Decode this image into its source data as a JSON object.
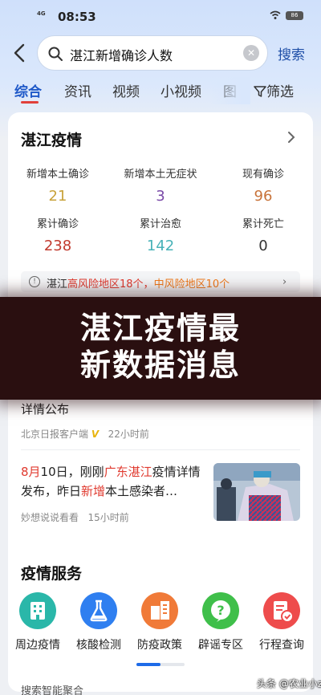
{
  "status_bar": {
    "network": "4G",
    "time": "08:53",
    "battery": "86"
  },
  "search": {
    "query": "湛江新增确诊人数",
    "button_label": "搜索"
  },
  "tabs": [
    {
      "label": "综合",
      "active": true
    },
    {
      "label": "资讯"
    },
    {
      "label": "视频"
    },
    {
      "label": "小视频"
    },
    {
      "label": "图"
    }
  ],
  "filter_label": "筛选",
  "card": {
    "title": "湛江疫情",
    "stats": [
      {
        "label": "新增本土确诊",
        "value": "21",
        "color": "#c8a23a"
      },
      {
        "label": "新增本土无症状",
        "value": "3",
        "color": "#7a4aa8"
      },
      {
        "label": "现有确诊",
        "value": "96",
        "color": "#c8733a"
      },
      {
        "label": "累计确诊",
        "value": "238",
        "color": "#c23a2e"
      },
      {
        "label": "累计治愈",
        "value": "142",
        "color": "#48b2b8"
      },
      {
        "label": "累计死亡",
        "value": "0",
        "color": "#333333"
      }
    ],
    "risk": {
      "prefix": "湛江",
      "high": "高风险地区18个，",
      "mid": "中风险地区10个"
    }
  },
  "overlay": {
    "line1": "湛江疫情最",
    "line2": "新数据消息"
  },
  "news": [
    {
      "title": "详情公布",
      "source": "北京日报客户端",
      "badge": "V",
      "time": "22小时前"
    },
    {
      "title_parts": [
        "8月",
        "10日，刚刚",
        "广东湛江",
        "疫情详情发布，昨日",
        "新增",
        "本土感染者…"
      ],
      "source": "妙想说说看看",
      "time": "15小时前"
    }
  ],
  "services": {
    "title": "疫情服务",
    "items": [
      {
        "label": "周边疫情",
        "icon": "building-icon",
        "color": "#2ab7a9"
      },
      {
        "label": "核酸检测",
        "icon": "test-tube-icon",
        "color": "#2f7ff0"
      },
      {
        "label": "防疫政策",
        "icon": "policy-building-icon",
        "color": "#f07a38"
      },
      {
        "label": "辟谣专区",
        "icon": "question-icon",
        "color": "#3fbf4a"
      },
      {
        "label": "行程查询",
        "icon": "itinerary-icon",
        "color": "#ee4c4c"
      }
    ]
  },
  "bottom_text": "搜索智能聚合",
  "watermark": "头条 @农业小z"
}
